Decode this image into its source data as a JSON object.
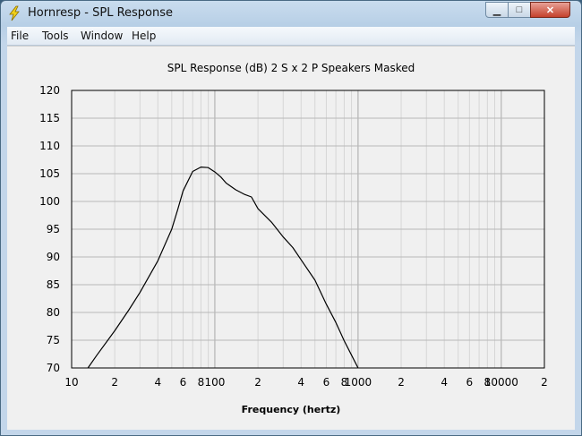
{
  "window": {
    "title": "Hornresp - SPL Response"
  },
  "menu": {
    "file": "File",
    "tools": "Tools",
    "window": "Window",
    "help": "Help"
  },
  "colors": {
    "plot_line": "#000000",
    "grid": "#c8c8c8",
    "background": "#f0f0f0"
  },
  "chart_data": {
    "type": "line",
    "title": "SPL Response (dB)   2 S x 2 P Speakers   Masked",
    "xlabel": "Frequency (hertz)",
    "ylabel": "",
    "xscale": "log",
    "xlim": [
      10,
      20000
    ],
    "ylim": [
      70,
      120
    ],
    "grid": true,
    "yticks": [
      70,
      75,
      80,
      85,
      90,
      95,
      100,
      105,
      110,
      115,
      120
    ],
    "xtick_values": [
      10,
      20,
      40,
      60,
      80,
      100,
      200,
      400,
      600,
      800,
      1000,
      2000,
      4000,
      6000,
      8000,
      10000,
      20000
    ],
    "xtick_labels": [
      "10",
      "2",
      "4",
      "6",
      "8",
      "100",
      "2",
      "4",
      "6",
      "8",
      "1000",
      "2",
      "4",
      "6",
      "8",
      "10000",
      "2"
    ],
    "series": [
      {
        "x": [
          13,
          15,
          20,
          25,
          30,
          40,
          50,
          55,
          60,
          70,
          80,
          90,
          100,
          110,
          120,
          140,
          160,
          180,
          200,
          250,
          300,
          350,
          400,
          500,
          600,
          700,
          800,
          900,
          1000
        ],
        "y": [
          70,
          72.3,
          76.7,
          80.4,
          83.6,
          89.3,
          95,
          98.5,
          101.9,
          105.4,
          106.2,
          106.1,
          105.3,
          104.4,
          103.3,
          102.1,
          101.3,
          100.8,
          98.7,
          96.2,
          93.6,
          91.7,
          89.5,
          85.8,
          81.5,
          78.2,
          74.9,
          72.3,
          70
        ]
      }
    ]
  }
}
